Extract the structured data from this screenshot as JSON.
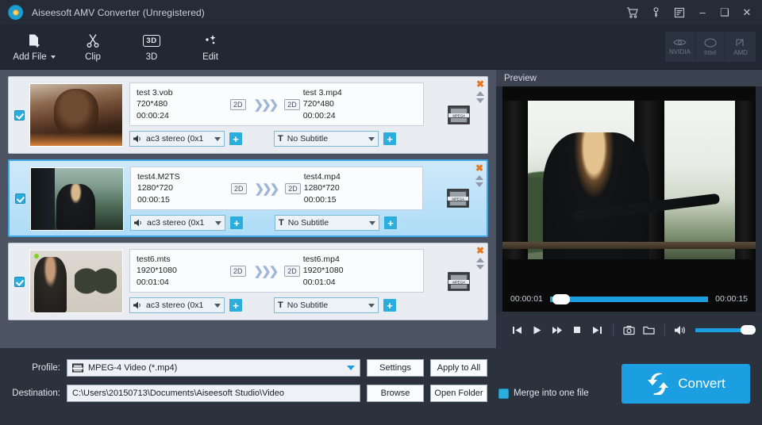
{
  "window": {
    "title": "Aiseesoft AMV Converter (Unregistered)",
    "logo_icon": "aiseesoft-logo-icon",
    "titlebar_icons": [
      "cart-icon",
      "key-icon",
      "register-icon"
    ],
    "controls": {
      "minimize": "–",
      "maximize": "❑",
      "close": "✕"
    }
  },
  "toolbar": {
    "items": [
      {
        "label": "Add File",
        "icon": "add-file-icon",
        "has_dropdown": true
      },
      {
        "label": "Clip",
        "icon": "scissors-icon",
        "has_dropdown": false
      },
      {
        "label": "3D",
        "icon": "3d-badge-icon",
        "has_dropdown": false
      },
      {
        "label": "Edit",
        "icon": "edit-sparkle-icon",
        "has_dropdown": false
      }
    ],
    "acceleration": [
      {
        "label": "NVIDIA",
        "icon": "nvidia-icon"
      },
      {
        "label": "Intel",
        "icon": "intel-icon"
      },
      {
        "label": "AMD",
        "icon": "amd-icon"
      }
    ]
  },
  "files": [
    {
      "checked": true,
      "selected": false,
      "source": {
        "name": "test 3.vob",
        "resolution": "720*480",
        "duration": "00:00:24",
        "dimension": "2D"
      },
      "output": {
        "name": "test 3.mp4",
        "resolution": "720*480",
        "duration": "00:00:24",
        "dimension": "2D"
      },
      "audio_track": "ac3 stereo (0x1",
      "subtitle": "No Subtitle",
      "format_icon": "mpeg4-filmstrip-icon"
    },
    {
      "checked": true,
      "selected": true,
      "source": {
        "name": "test4.M2TS",
        "resolution": "1280*720",
        "duration": "00:00:15",
        "dimension": "2D"
      },
      "output": {
        "name": "test4.mp4",
        "resolution": "1280*720",
        "duration": "00:00:15",
        "dimension": "2D"
      },
      "audio_track": "ac3 stereo (0x1",
      "subtitle": "No Subtitle",
      "format_icon": "mpeg4-filmstrip-icon"
    },
    {
      "checked": true,
      "selected": false,
      "source": {
        "name": "test6.mts",
        "resolution": "1920*1080",
        "duration": "00:01:04",
        "dimension": "2D"
      },
      "output": {
        "name": "test6.mp4",
        "resolution": "1920*1080",
        "duration": "00:01:04",
        "dimension": "2D"
      },
      "audio_track": "ac3 stereo (0x1",
      "subtitle": "No Subtitle",
      "format_icon": "mpeg4-filmstrip-icon"
    }
  ],
  "row_actions": {
    "remove": "✖",
    "move_up": "move-up-icon",
    "move_down": "move-down-icon"
  },
  "preview": {
    "title": "Preview",
    "current_time": "00:00:01",
    "total_time": "00:00:15",
    "progress_percent": 7,
    "volume_percent": 100,
    "transport": [
      {
        "name": "previous-button",
        "glyph": "⏮"
      },
      {
        "name": "play-button",
        "glyph": "▶"
      },
      {
        "name": "forward-button",
        "glyph": "⏩"
      },
      {
        "name": "stop-button",
        "glyph": "■"
      },
      {
        "name": "next-button",
        "glyph": "⏭"
      },
      {
        "name": "snapshot-button",
        "glyph": "▣"
      },
      {
        "name": "open-snapshot-folder-button",
        "glyph": "▮"
      }
    ]
  },
  "bottom": {
    "profile_label": "Profile:",
    "profile_value": "MPEG-4 Video (*.mp4)",
    "profile_icon": "video-format-icon",
    "settings_label": "Settings",
    "apply_all_label": "Apply to All",
    "destination_label": "Destination:",
    "destination_value": "C:\\Users\\20150713\\Documents\\Aiseesoft Studio\\Video",
    "browse_label": "Browse",
    "open_folder_label": "Open Folder",
    "merge_label": "Merge into one file",
    "merge_checked": true,
    "convert_label": "Convert",
    "convert_icon": "convert-arrows-icon",
    "accent_color": "#1c9fe0"
  }
}
